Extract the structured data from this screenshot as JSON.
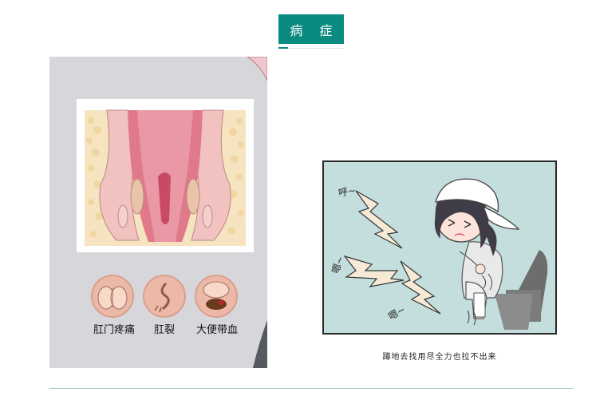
{
  "header": {
    "title": "病 症",
    "accent_color": "#0b8a80"
  },
  "left_illustration": {
    "symptoms": [
      {
        "label": "肛门疼痛",
        "icon": "buttocks-pain-icon"
      },
      {
        "label": "肛裂",
        "icon": "fissure-icon"
      },
      {
        "label": "大便带血",
        "icon": "bloody-stool-icon"
      }
    ]
  },
  "right_illustration": {
    "caption": "蹲地去找用尽全力也拉不出来",
    "sounds": [
      "呼~",
      "嗯~",
      "嗯~"
    ]
  }
}
